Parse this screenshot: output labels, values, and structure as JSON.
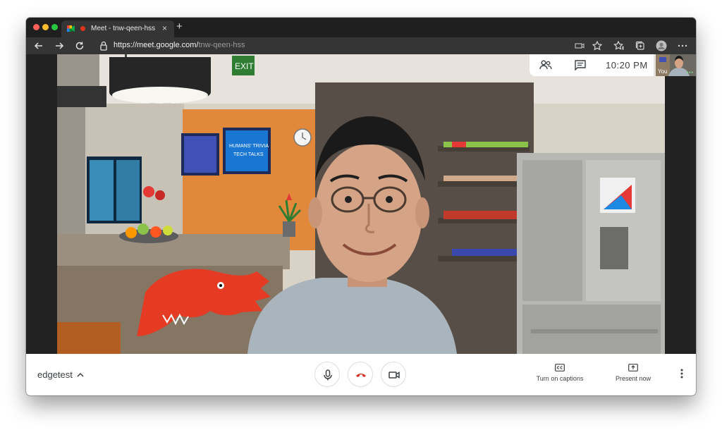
{
  "browser": {
    "tab_title": "Meet - tnw-qeen-hss",
    "tab_close": "×",
    "new_tab": "+",
    "url_host": "https://meet.google.com/",
    "url_path": "tnw-qeen-hss"
  },
  "meet": {
    "clock": "10:20 PM",
    "self_label": "You",
    "self_dots": "•••",
    "meeting_name": "edgetest",
    "captions_label": "Turn on captions",
    "present_label": "Present now"
  },
  "scene": {
    "exit_sign": "EXIT",
    "tv_text_line1": "HUMANS' TRIVIA",
    "tv_text_line2": "TECH TALKS"
  },
  "icons": {
    "nav": [
      "back-arrow-icon",
      "forward-arrow-icon",
      "reload-icon",
      "lock-icon"
    ],
    "toolbar": [
      "video-icon",
      "star-icon",
      "favorites-icon",
      "collections-icon",
      "profile-avatar-icon",
      "more-icon"
    ],
    "meet": [
      "people-icon",
      "chat-icon",
      "mic-icon",
      "hang-up-icon",
      "camera-icon",
      "captions-icon",
      "present-icon",
      "more-vert-icon"
    ]
  },
  "colors": {
    "hangup_red": "#d93025",
    "meet_text": "#3c4043",
    "tab_rec_dot": "#e0341d"
  }
}
